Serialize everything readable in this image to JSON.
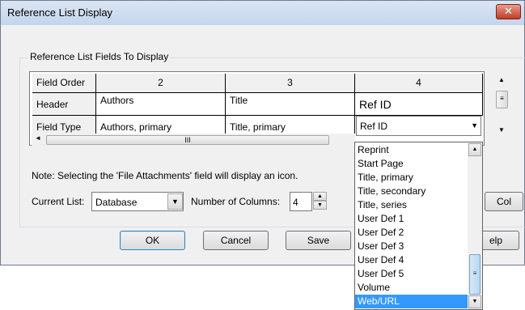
{
  "window": {
    "title": "Reference List Display",
    "close_glyph": "✕"
  },
  "group": {
    "label": "Reference List Fields To Display"
  },
  "grid": {
    "row_headers": [
      "Field Order",
      "Header",
      "Field Type"
    ],
    "columns": [
      {
        "order": "2",
        "header": "Authors",
        "field_type": "Authors, primary"
      },
      {
        "order": "3",
        "header": "Title",
        "field_type": "Title, primary"
      },
      {
        "order": "4",
        "header": "Ref ID",
        "field_type": "Ref ID"
      }
    ],
    "hscroll_thumb_glyph": "III",
    "dropdown_arrow": "▼"
  },
  "dropdown_list": {
    "items": [
      "Reprint",
      "Start Page",
      "Title, primary",
      "Title, secondary",
      "Title, series",
      "User Def 1",
      "User Def 2",
      "User Def 3",
      "User Def 4",
      "User Def 5",
      "Volume",
      "Web/URL"
    ],
    "selected": "Web/URL",
    "scroll_up": "▲",
    "scroll_down": "▼",
    "thumb_glyph": "≡"
  },
  "note": "Note: Selecting the 'File Attachments' field will display an icon.",
  "current_list": {
    "label": "Current List:",
    "value": "Database"
  },
  "num_columns": {
    "label": "Number of Columns:",
    "value": "4"
  },
  "buttons": {
    "ok": "OK",
    "cancel": "Cancel",
    "save": "Save",
    "col": "Col",
    "help": "elp"
  },
  "icons": {
    "scroll_up": "▲",
    "scroll_down": "▼",
    "scroll_left": "◄",
    "scroll_right": "►",
    "spin_up": "▲",
    "spin_down": "▼"
  }
}
